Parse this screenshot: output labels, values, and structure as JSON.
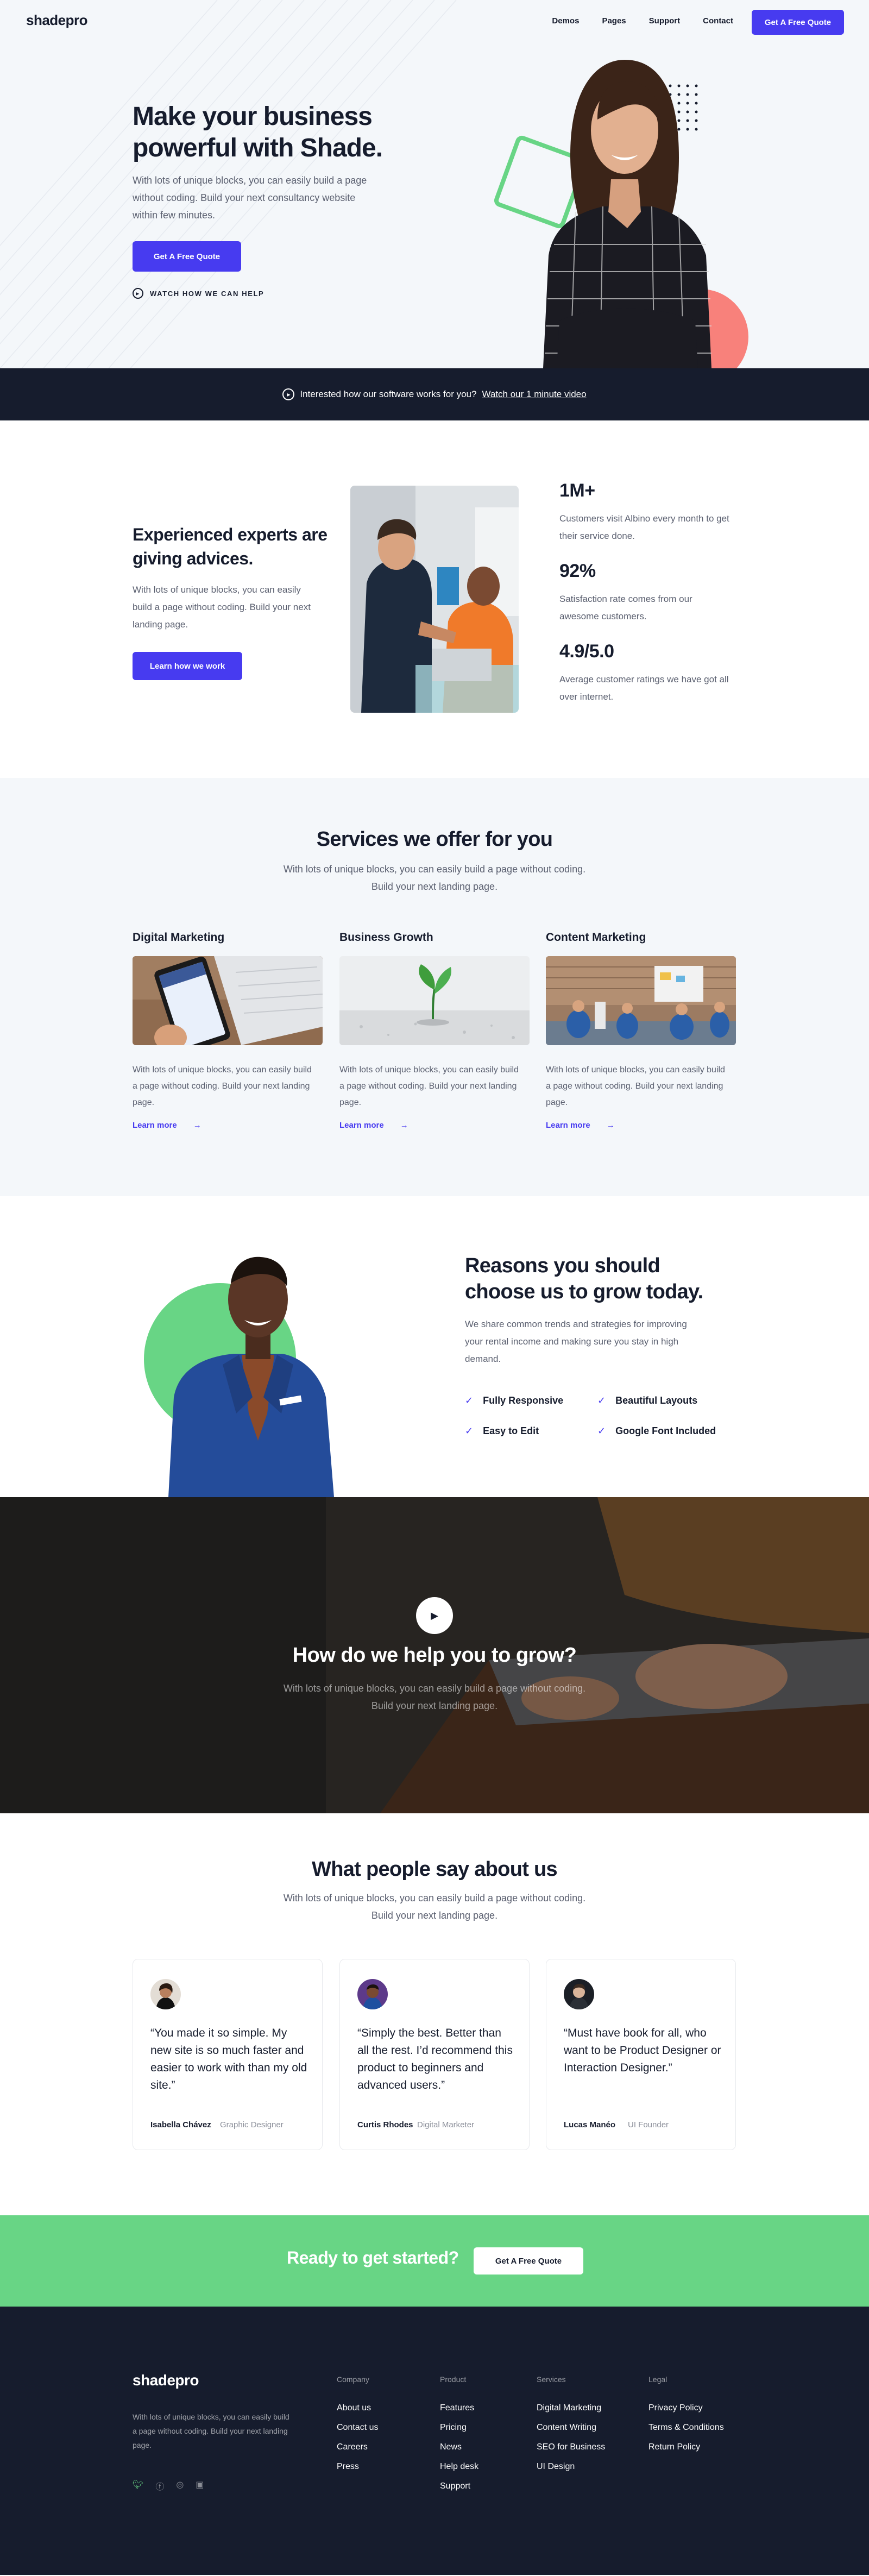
{
  "brand": {
    "logo": "shadepro",
    "accent": "#473bf0",
    "green": "#68d585",
    "dark": "#161c2d"
  },
  "nav": {
    "items": [
      "Demos",
      "Pages",
      "Support",
      "Contact"
    ],
    "cta": "Get A Free Quote"
  },
  "hero": {
    "title": "Make your business powerful with Shade.",
    "text": "With lots of unique blocks, you can easily build a page without coding. Build your next consultancy website within few minutes.",
    "cta": "Get A Free Quote",
    "watch": "WATCH HOW WE CAN HELP"
  },
  "banner": {
    "text": "Interested how our software works for you?",
    "link": "Watch our 1 minute video"
  },
  "experts": {
    "title": "Experienced experts are giving advices.",
    "text": "With lots of unique blocks, you can easily build a page without coding. Build your next landing page.",
    "button": "Learn how we work",
    "stats": [
      {
        "value": "1M+",
        "text": "Customers visit Albino every month to get their service done."
      },
      {
        "value": "92%",
        "text": "Satisfaction rate comes from our awesome customers."
      },
      {
        "value": "4.9/5.0",
        "text": "Average customer ratings we have got all over internet."
      }
    ]
  },
  "services": {
    "title": "Services we offer for you",
    "subtitle": "With lots of unique blocks, you can easily build a page without coding. Build your next landing page.",
    "items": [
      {
        "title": "Digital Marketing",
        "text": "With lots of unique blocks, you can easily build a page without coding. Build your next landing page.",
        "link": "Learn more"
      },
      {
        "title": "Business Growth",
        "text": "With lots of unique blocks, you can easily build a page without coding. Build your next landing page.",
        "link": "Learn more"
      },
      {
        "title": "Content Marketing",
        "text": "With lots of unique blocks, you can easily build a page without coding. Build your next landing page.",
        "link": "Learn more"
      }
    ]
  },
  "reasons": {
    "title": "Reasons you should choose us to grow today.",
    "text": "We share common trends and strategies for improving your rental income and making sure you stay in high demand.",
    "features": [
      "Fully Responsive",
      "Beautiful Layouts",
      "Easy to Edit",
      "Google Font Included"
    ]
  },
  "video": {
    "title": "How do we help you to grow?",
    "subtitle": "With lots of unique blocks, you can easily build a page without coding. Build your next landing page."
  },
  "testimonials": {
    "title": "What people say about us",
    "subtitle": "With lots of unique blocks, you can easily build a page without coding. Build your next landing page.",
    "items": [
      {
        "quote": "“You made it so simple. My new site is so much faster and easier to work with than my old site.”",
        "name": "Isabella Chávez",
        "role": "Graphic Designer"
      },
      {
        "quote": "“Simply the best. Better than all the rest. I’d recommend this product to beginners and advanced users.”",
        "name": "Curtis Rhodes",
        "role": "Digital Marketer"
      },
      {
        "quote": "“Must have book for all, who want to be Product Designer or Interaction Designer.”",
        "name": "Lucas Manéo",
        "role": "UI Founder"
      }
    ]
  },
  "cta": {
    "text": "Ready to get started?",
    "button": "Get A Free Quote"
  },
  "footer": {
    "logo": "shadepro",
    "text": "With lots of unique blocks, you can easily build a page without coding. Build your next landing page.",
    "columns": [
      {
        "head": "Company",
        "items": [
          "About us",
          "Contact us",
          "Careers",
          "Press"
        ]
      },
      {
        "head": "Product",
        "items": [
          "Features",
          "Pricing",
          "News",
          "Help desk",
          "Support"
        ]
      },
      {
        "head": "Services",
        "items": [
          "Digital Marketing",
          "Content Writing",
          "SEO for Business",
          "UI Design"
        ]
      },
      {
        "head": "Legal",
        "items": [
          "Privacy Policy",
          "Terms & Conditions",
          "Return Policy"
        ]
      }
    ],
    "social": [
      "twitter-icon",
      "facebook-icon",
      "instagram-icon",
      "linkedin-icon"
    ]
  }
}
